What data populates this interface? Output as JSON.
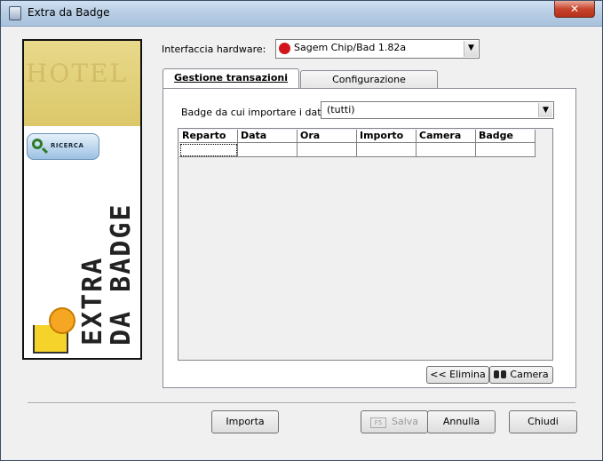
{
  "window": {
    "title": "Extra da Badge",
    "close_label": "✕"
  },
  "banner": {
    "logo_text": "HOTEL",
    "search_label": "RICERCA",
    "vertical_line1": "EXTRA",
    "vertical_line2": "DA BADGE"
  },
  "hardware": {
    "label": "Interfaccia hardware:",
    "selected": "Sagem Chip/Bad 1.82a"
  },
  "tabs": [
    {
      "label": "Gestione transazioni",
      "active": true
    },
    {
      "label": "Configurazione",
      "active": false
    }
  ],
  "badge_filter": {
    "label": "Badge da cui importare i dati:",
    "selected": "(tutti)"
  },
  "table": {
    "columns": [
      "Reparto",
      "Data",
      "Ora",
      "Importo",
      "Camera",
      "Badge"
    ],
    "rows": [
      [
        "",
        "",
        "",
        "",
        "",
        ""
      ]
    ]
  },
  "actions": {
    "elimina": "<< Elimina",
    "camera": "Camera",
    "importa": "Importa",
    "salva": "Salva",
    "salva_key": "F5",
    "annulla": "Annulla",
    "chiudi": "Chiudi"
  },
  "colors": {
    "sagem_red": "#d3141a",
    "search_icon_green": "#2f7a2a",
    "banner_gold": "#dcc86a"
  }
}
